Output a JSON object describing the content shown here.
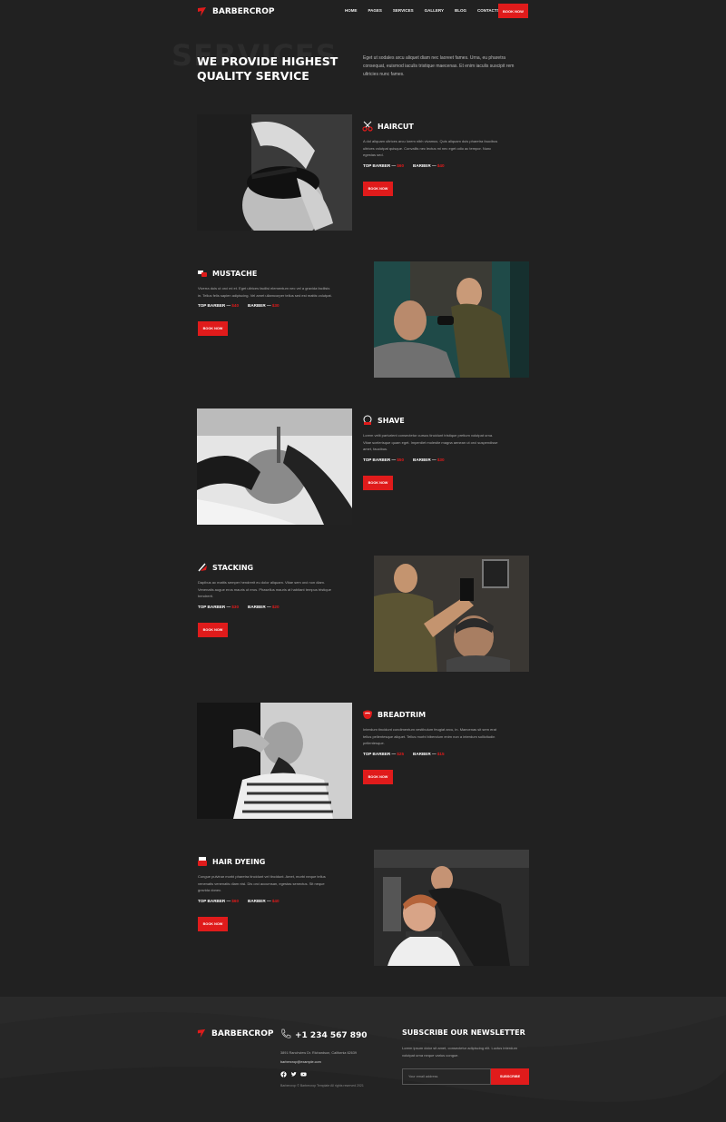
{
  "brand": {
    "name": "BARBERCROP",
    "accent": "#e01b1b"
  },
  "nav": {
    "items": [
      "HOME",
      "PAGES",
      "SERVICES",
      "GALLERY",
      "BLOG",
      "CONTACTS"
    ],
    "cta": "BOOK NOW"
  },
  "hero": {
    "ghost": "SERVICES",
    "title": "WE PROVIDE HIGHEST QUALITY SERVICE",
    "desc": "Eget ut sodales arcu aliquet diam nec laoreet fames. Urna, eu pharetra consequat, euismod iaculis tristique maecenas. Et enim iaculis suscipit rem ultricies nunc fames."
  },
  "services": [
    {
      "title": "HAIRCUT",
      "icon": "scissors-icon",
      "desc": "A dol aliquam ultrices arcu lorem nibh vivamus. Quis aliquam duis pharetra faucibus ultrices volutpat quisque. Convallis nec lectus mi nec eget odio ac tempor. Nunc egestas sed.",
      "top_label": "TOP BARBER —",
      "top_price": "$60",
      "barber_label": "BARBER —",
      "barber_price": "$40",
      "button": "BOOK NOW"
    },
    {
      "title": "MUSTACHE",
      "icon": "razor-icon",
      "desc": "Viverra duis ut orci mi et. Eget ultrices facilisi elementum nec vel a gravida facilisis in. Tellus felis sapien adipiscing. Vel amet ullamcorper tellus sed est mattis volutpat.",
      "top_label": "TOP BARBER —",
      "top_price": "$40",
      "barber_label": "BARBER —",
      "barber_price": "$30",
      "button": "BOOK NOW"
    },
    {
      "title": "SHAVE",
      "icon": "shaving-icon",
      "desc": "Lorem velit parturient consectetur cursus tincidunt tristique pretium volutpat urna. Vitae scelerisque quam eget. Imperdiet molestie magna aenean ut orci suspendisse amet, faucibus.",
      "top_label": "TOP BARBER —",
      "top_price": "$50",
      "barber_label": "BARBER —",
      "barber_price": "$30",
      "button": "BOOK NOW"
    },
    {
      "title": "STACKING",
      "icon": "comb-icon",
      "desc": "Dapibus ac mattis semper hendrerit eu dolor aliquam. Vitae sem orci non diam. Venenatis augue eros mauris ut eros. Phasellus mauris at habitant tempus tristique hendrerit.",
      "top_label": "TOP BARBER —",
      "top_price": "$30",
      "barber_label": "BARBER —",
      "barber_price": "$20",
      "button": "BOOK NOW"
    },
    {
      "title": "BREADTRIM",
      "icon": "beard-icon",
      "desc": "Interdum tincidunt condimentum vestibulum feugiat arcu, in. Maecenas sit sem erat tellus pellentesque aliquet. Tellus morbi bibendum enim non a interdum sollicitudin pellentesque.",
      "top_label": "TOP BARBER —",
      "top_price": "$25",
      "barber_label": "BARBER —",
      "barber_price": "$15",
      "button": "BOOK NOW"
    },
    {
      "title": "HAIR DYEING",
      "icon": "dye-icon",
      "desc": "Congue pulvinar morbi pharetra tincidunt vel tincidunt. Amet, morbi neque tellus venenatis venenatis diam nisl. Dis orci accumsan, egestas senectus. Sit neque gravida donec.",
      "top_label": "TOP BARBER —",
      "top_price": "$60",
      "barber_label": "BARBER —",
      "barber_price": "$40",
      "button": "BOOK NOW"
    }
  ],
  "footer": {
    "brand": "BARBERCROP",
    "phone": "+1 234 567 890",
    "address": "3891 Ranchview Dr. Richardson, California 62639",
    "email": "barbercrop@example.com",
    "copyright": "Barbercrop © Barbercrop Template All rights reserved 2021",
    "newsletter_title": "SUBSCRIBE OUR NEWSLETTER",
    "newsletter_desc": "Lorem ipsum dolor sit amet, consectetur adipiscing elit. Luctus interdum volutpat urna neque varius congue.",
    "email_placeholder": "Your email address",
    "subscribe": "SUBSCRIBE"
  }
}
